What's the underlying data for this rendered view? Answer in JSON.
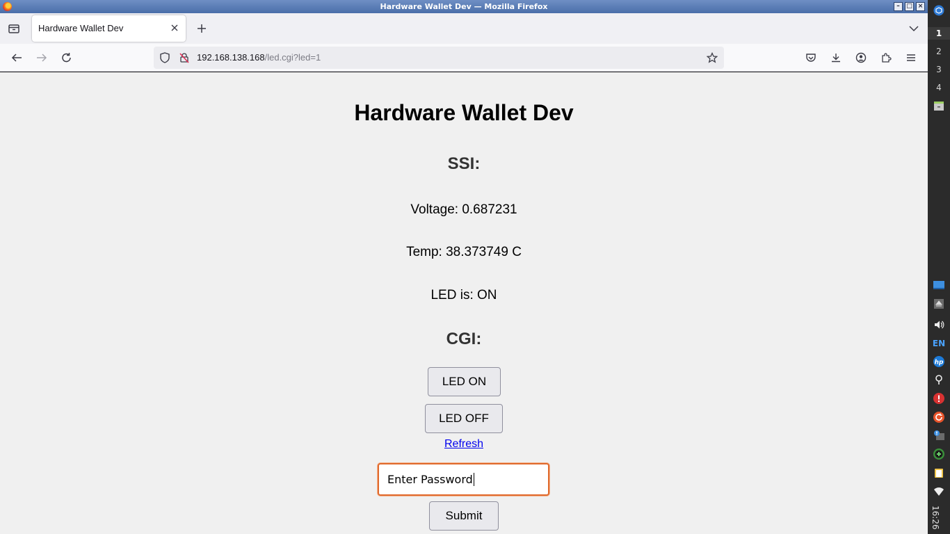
{
  "window": {
    "title": "Hardware Wallet Dev — Mozilla Firefox",
    "minimize": "–",
    "maximize": "□",
    "close": "×"
  },
  "tabs": [
    {
      "label": "Hardware Wallet Dev"
    }
  ],
  "navbar": {
    "url_host": "192.168.138.168",
    "url_path": "/led.cgi?led=1"
  },
  "page": {
    "title": "Hardware Wallet Dev",
    "ssi_heading": "SSI:",
    "voltage": "Voltage: 0.687231",
    "temp": "Temp: 38.373749 C",
    "led_status": "LED is: ON",
    "cgi_heading": "CGI:",
    "led_on_label": "LED ON",
    "led_off_label": "LED OFF",
    "refresh_label": "Refresh",
    "password_value": "Enter Password",
    "submit_label": "Submit"
  },
  "panel": {
    "workspaces": [
      "1",
      "2",
      "3",
      "4"
    ],
    "language": "EN",
    "clock": "16:26"
  }
}
